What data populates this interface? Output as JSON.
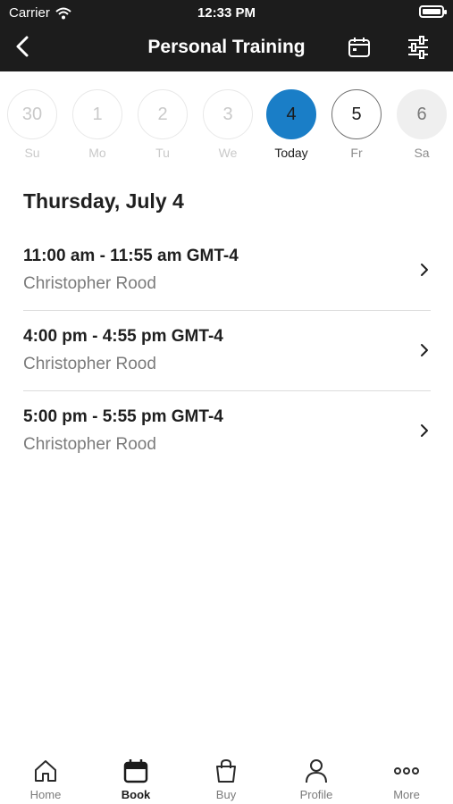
{
  "status_bar": {
    "carrier": "Carrier",
    "time": "12:33 PM"
  },
  "nav": {
    "title": "Personal Training"
  },
  "days": [
    {
      "num": "30",
      "label": "Su",
      "state": "past"
    },
    {
      "num": "1",
      "label": "Mo",
      "state": "past"
    },
    {
      "num": "2",
      "label": "Tu",
      "state": "past"
    },
    {
      "num": "3",
      "label": "We",
      "state": "past"
    },
    {
      "num": "4",
      "label": "Today",
      "state": "today"
    },
    {
      "num": "5",
      "label": "Fr",
      "state": "future"
    },
    {
      "num": "6",
      "label": "Sa",
      "state": "weekend"
    }
  ],
  "date_heading": "Thursday, July 4",
  "sessions": [
    {
      "time": "11:00 am - 11:55 am GMT-4",
      "trainer": "Christopher Rood"
    },
    {
      "time": "4:00 pm - 4:55 pm GMT-4",
      "trainer": "Christopher Rood"
    },
    {
      "time": "5:00 pm - 5:55 pm GMT-4",
      "trainer": "Christopher Rood"
    }
  ],
  "tabs": [
    {
      "label": "Home",
      "icon": "home-icon"
    },
    {
      "label": "Book",
      "icon": "calendar-icon",
      "active": true
    },
    {
      "label": "Buy",
      "icon": "shopping-bag-icon"
    },
    {
      "label": "Profile",
      "icon": "person-icon"
    },
    {
      "label": "More",
      "icon": "more-dots-icon"
    }
  ],
  "colors": {
    "accent": "#1a7ec7",
    "header_bg": "#1c1c1c"
  }
}
